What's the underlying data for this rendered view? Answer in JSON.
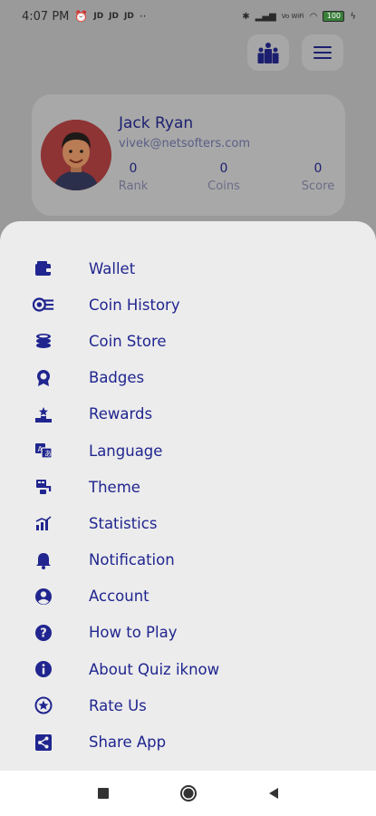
{
  "status_bar": {
    "time": "4:07 PM",
    "indicators": [
      "JD",
      "JD",
      "JD"
    ],
    "more": "··",
    "network": "Vo WiFi",
    "battery": "100"
  },
  "profile": {
    "name": "Jack Ryan",
    "email": "vivek@netsofters.com",
    "stats": [
      {
        "value": "0",
        "label": "Rank"
      },
      {
        "value": "0",
        "label": "Coins"
      },
      {
        "value": "0",
        "label": "Score"
      }
    ]
  },
  "menu": {
    "items": [
      {
        "label": "Wallet",
        "icon": "wallet-icon"
      },
      {
        "label": "Coin History",
        "icon": "coin-history-icon"
      },
      {
        "label": "Coin Store",
        "icon": "coin-store-icon"
      },
      {
        "label": "Badges",
        "icon": "badge-icon"
      },
      {
        "label": "Rewards",
        "icon": "rewards-icon"
      },
      {
        "label": "Language",
        "icon": "language-icon"
      },
      {
        "label": "Theme",
        "icon": "theme-icon"
      },
      {
        "label": "Statistics",
        "icon": "statistics-icon"
      },
      {
        "label": "Notification",
        "icon": "bell-icon"
      },
      {
        "label": "Account",
        "icon": "account-icon"
      },
      {
        "label": "How to Play",
        "icon": "help-icon"
      },
      {
        "label": "About Quiz iknow",
        "icon": "info-icon"
      },
      {
        "label": "Rate Us",
        "icon": "star-icon"
      },
      {
        "label": "Share App",
        "icon": "share-icon"
      }
    ]
  },
  "colors": {
    "accent": "#20258f",
    "sheet_background": "#ececec",
    "scrim": "#9a9a9a"
  }
}
